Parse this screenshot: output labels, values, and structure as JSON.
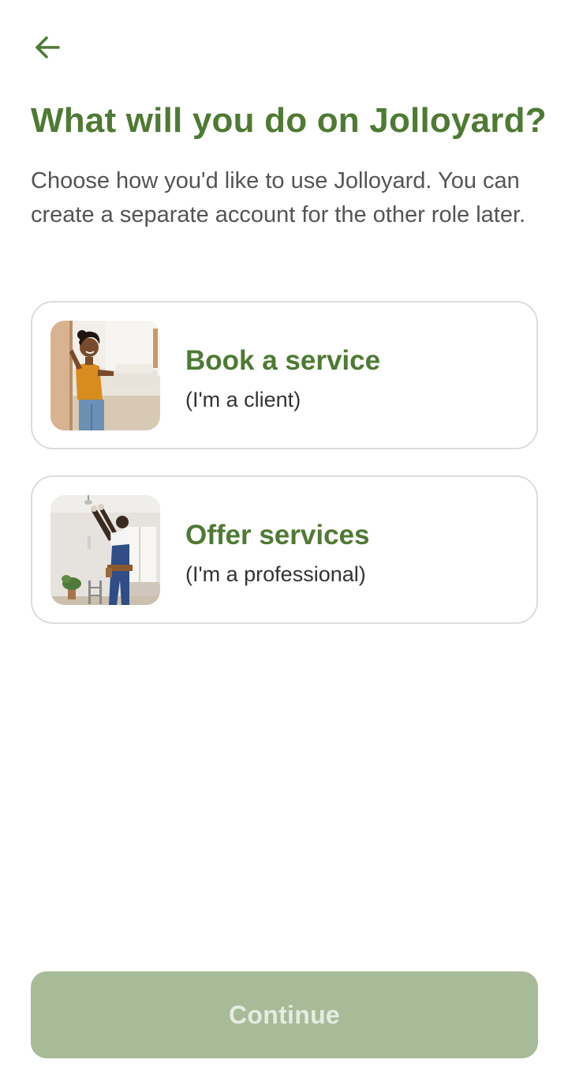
{
  "header": {
    "back_icon": "arrow-left-icon"
  },
  "page": {
    "title": "What will you do on Jolloyard?",
    "subtitle": "Choose how you'd like to use Jolloyard. You can create a separate account for the other role later."
  },
  "options": [
    {
      "title": "Book a service",
      "subtitle": "(I'm a client)",
      "image": "client-photo"
    },
    {
      "title": "Offer services",
      "subtitle": "(I'm a professional)",
      "image": "professional-photo"
    }
  ],
  "footer": {
    "continue_label": "Continue",
    "continue_enabled": false
  },
  "colors": {
    "accent_green": "#4e7a33",
    "disabled_button": "#a7bb98",
    "card_border": "#dcdcdc"
  }
}
